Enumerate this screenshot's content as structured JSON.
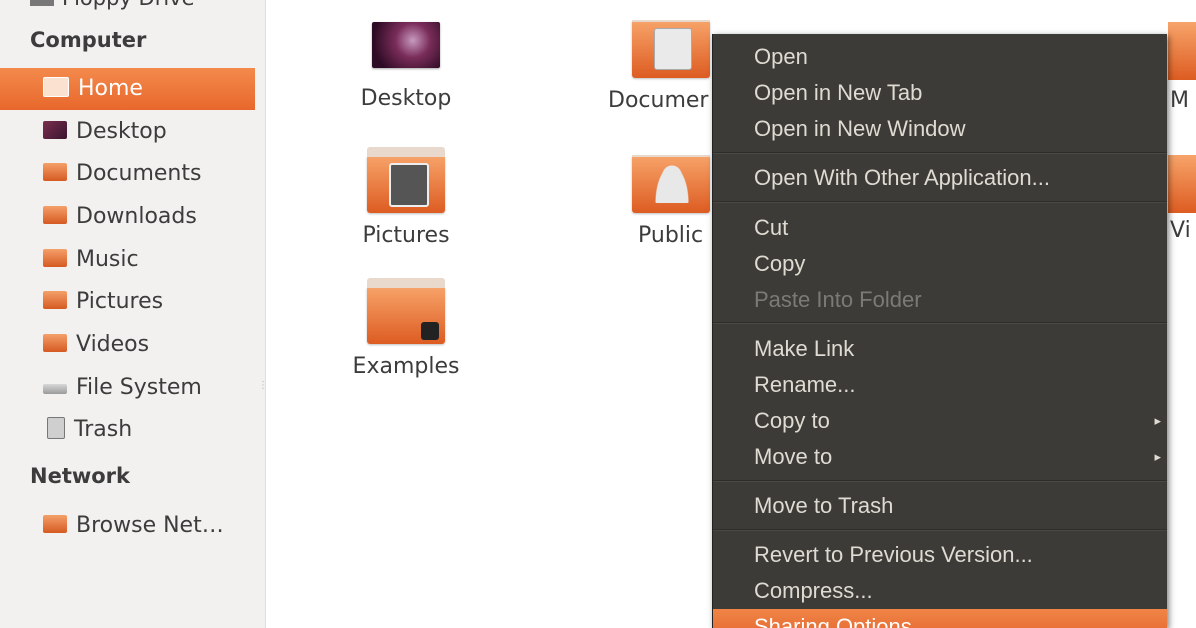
{
  "sidebar": {
    "cut_item": "Floppy Drive",
    "computer_header": "Computer",
    "items": [
      {
        "label": "Home",
        "icon": "home-folder-icon"
      },
      {
        "label": "Desktop",
        "icon": "desktop-icon"
      },
      {
        "label": "Documents",
        "icon": "documents-folder-icon"
      },
      {
        "label": "Downloads",
        "icon": "downloads-folder-icon"
      },
      {
        "label": "Music",
        "icon": "music-folder-icon"
      },
      {
        "label": "Pictures",
        "icon": "pictures-folder-icon"
      },
      {
        "label": "Videos",
        "icon": "videos-folder-icon"
      },
      {
        "label": "File System",
        "icon": "drive-icon"
      },
      {
        "label": "Trash",
        "icon": "trash-icon"
      }
    ],
    "network_header": "Network",
    "network_items": [
      {
        "label": "Browse Net…",
        "icon": "network-icon"
      }
    ]
  },
  "files": [
    {
      "label": "Desktop"
    },
    {
      "label": "Documer"
    },
    {
      "label": "Pictures"
    },
    {
      "label": "Public"
    },
    {
      "label": "Examples"
    }
  ],
  "edge_labels": [
    "M",
    "Vi"
  ],
  "context_menu": {
    "items": [
      {
        "label": "Open"
      },
      {
        "label": "Open in New Tab"
      },
      {
        "label": "Open in New Window"
      },
      {
        "label": "Open With Other Application..."
      },
      {
        "label": "Cut"
      },
      {
        "label": "Copy"
      },
      {
        "label": "Paste Into Folder"
      },
      {
        "label": "Make Link"
      },
      {
        "label": "Rename..."
      },
      {
        "label": "Copy to"
      },
      {
        "label": "Move to"
      },
      {
        "label": "Move to Trash"
      },
      {
        "label": "Revert to Previous Version..."
      },
      {
        "label": "Compress..."
      },
      {
        "label": "Sharing Options"
      }
    ],
    "submenu_arrow": "▸"
  },
  "colors": {
    "accent": "#e8672c",
    "menu_bg": "#3c3b37",
    "menu_text": "#dfdbd2",
    "menu_disabled": "#7c7a74",
    "sidebar_bg": "#f2f1f0"
  }
}
